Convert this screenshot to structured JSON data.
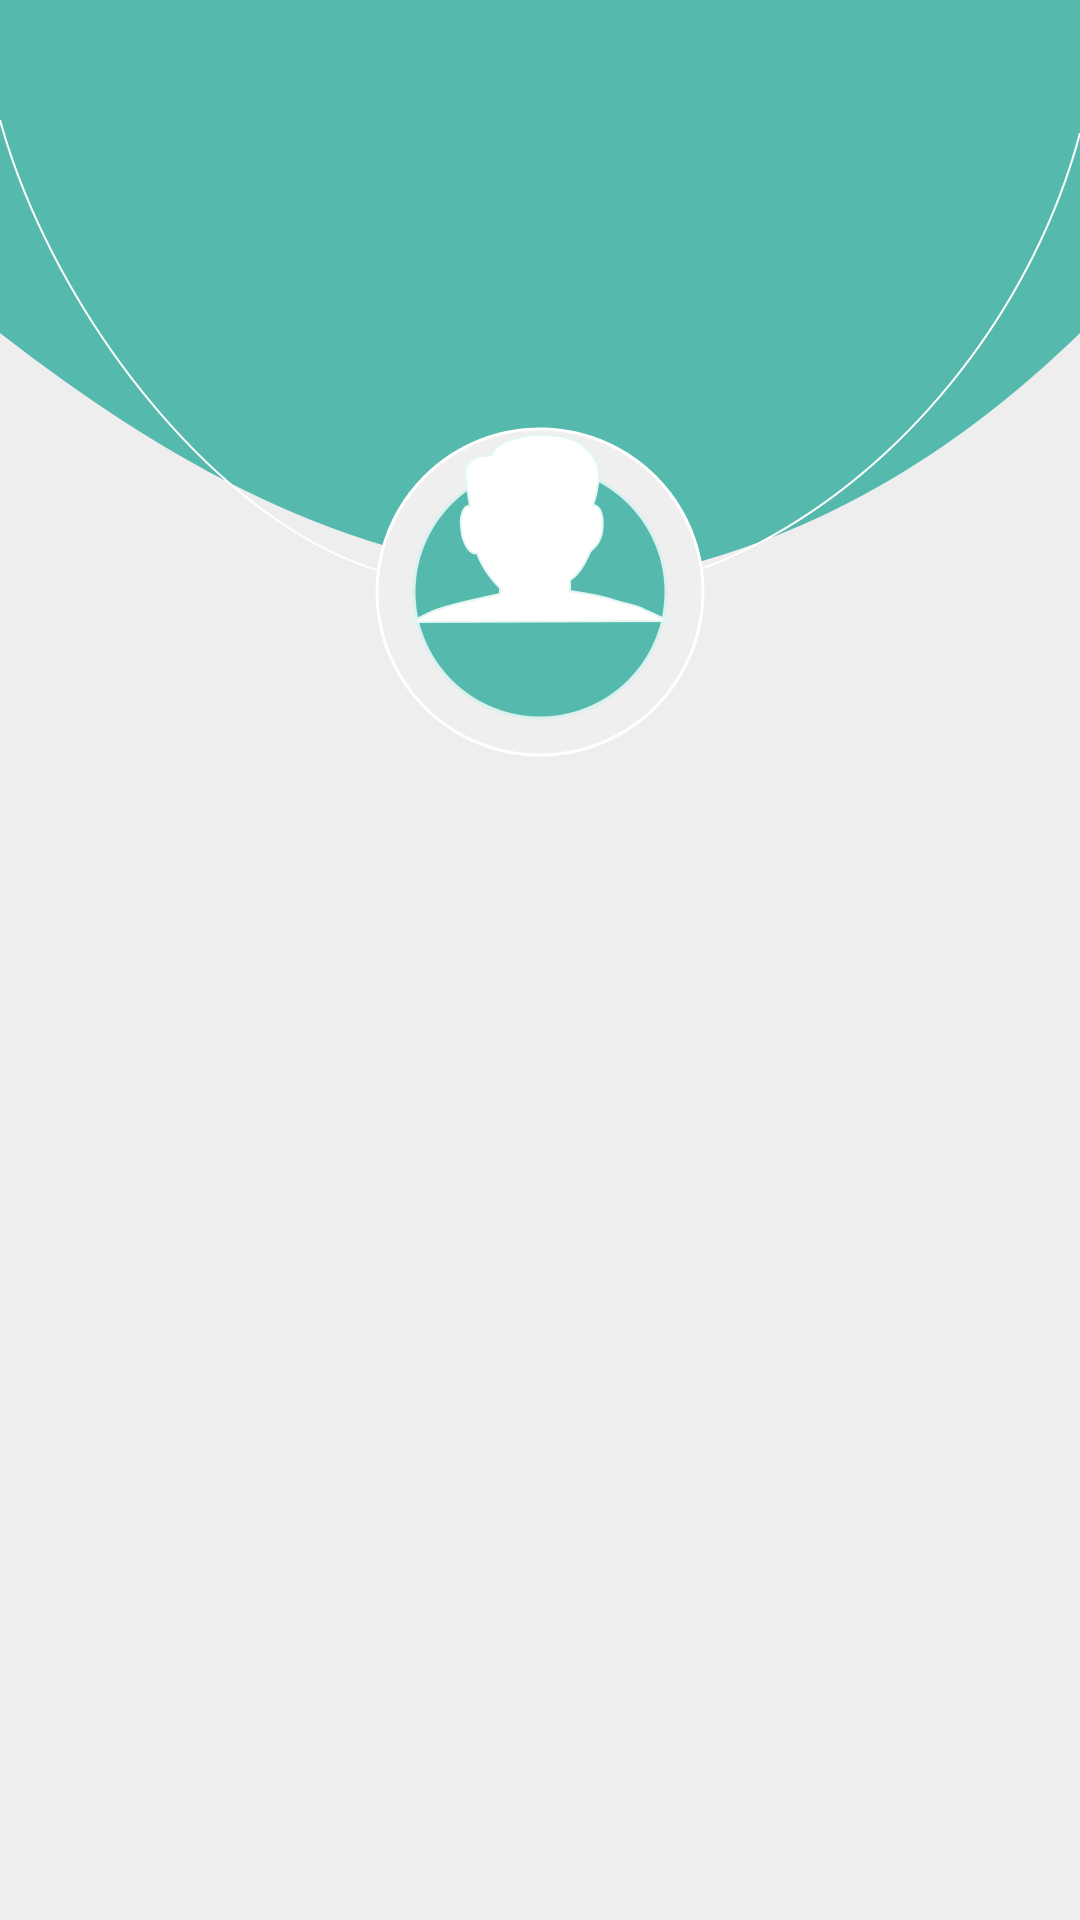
{
  "theme": {
    "background": "#eeeeee",
    "accent": "#56b9ad",
    "line": "#ffffff"
  },
  "header": {
    "shape": "teal-arc-header"
  },
  "profile": {
    "avatar_icon": "user-silhouette-icon",
    "avatar_fill": "#56b9ad",
    "ring_fill": "#efefef"
  }
}
